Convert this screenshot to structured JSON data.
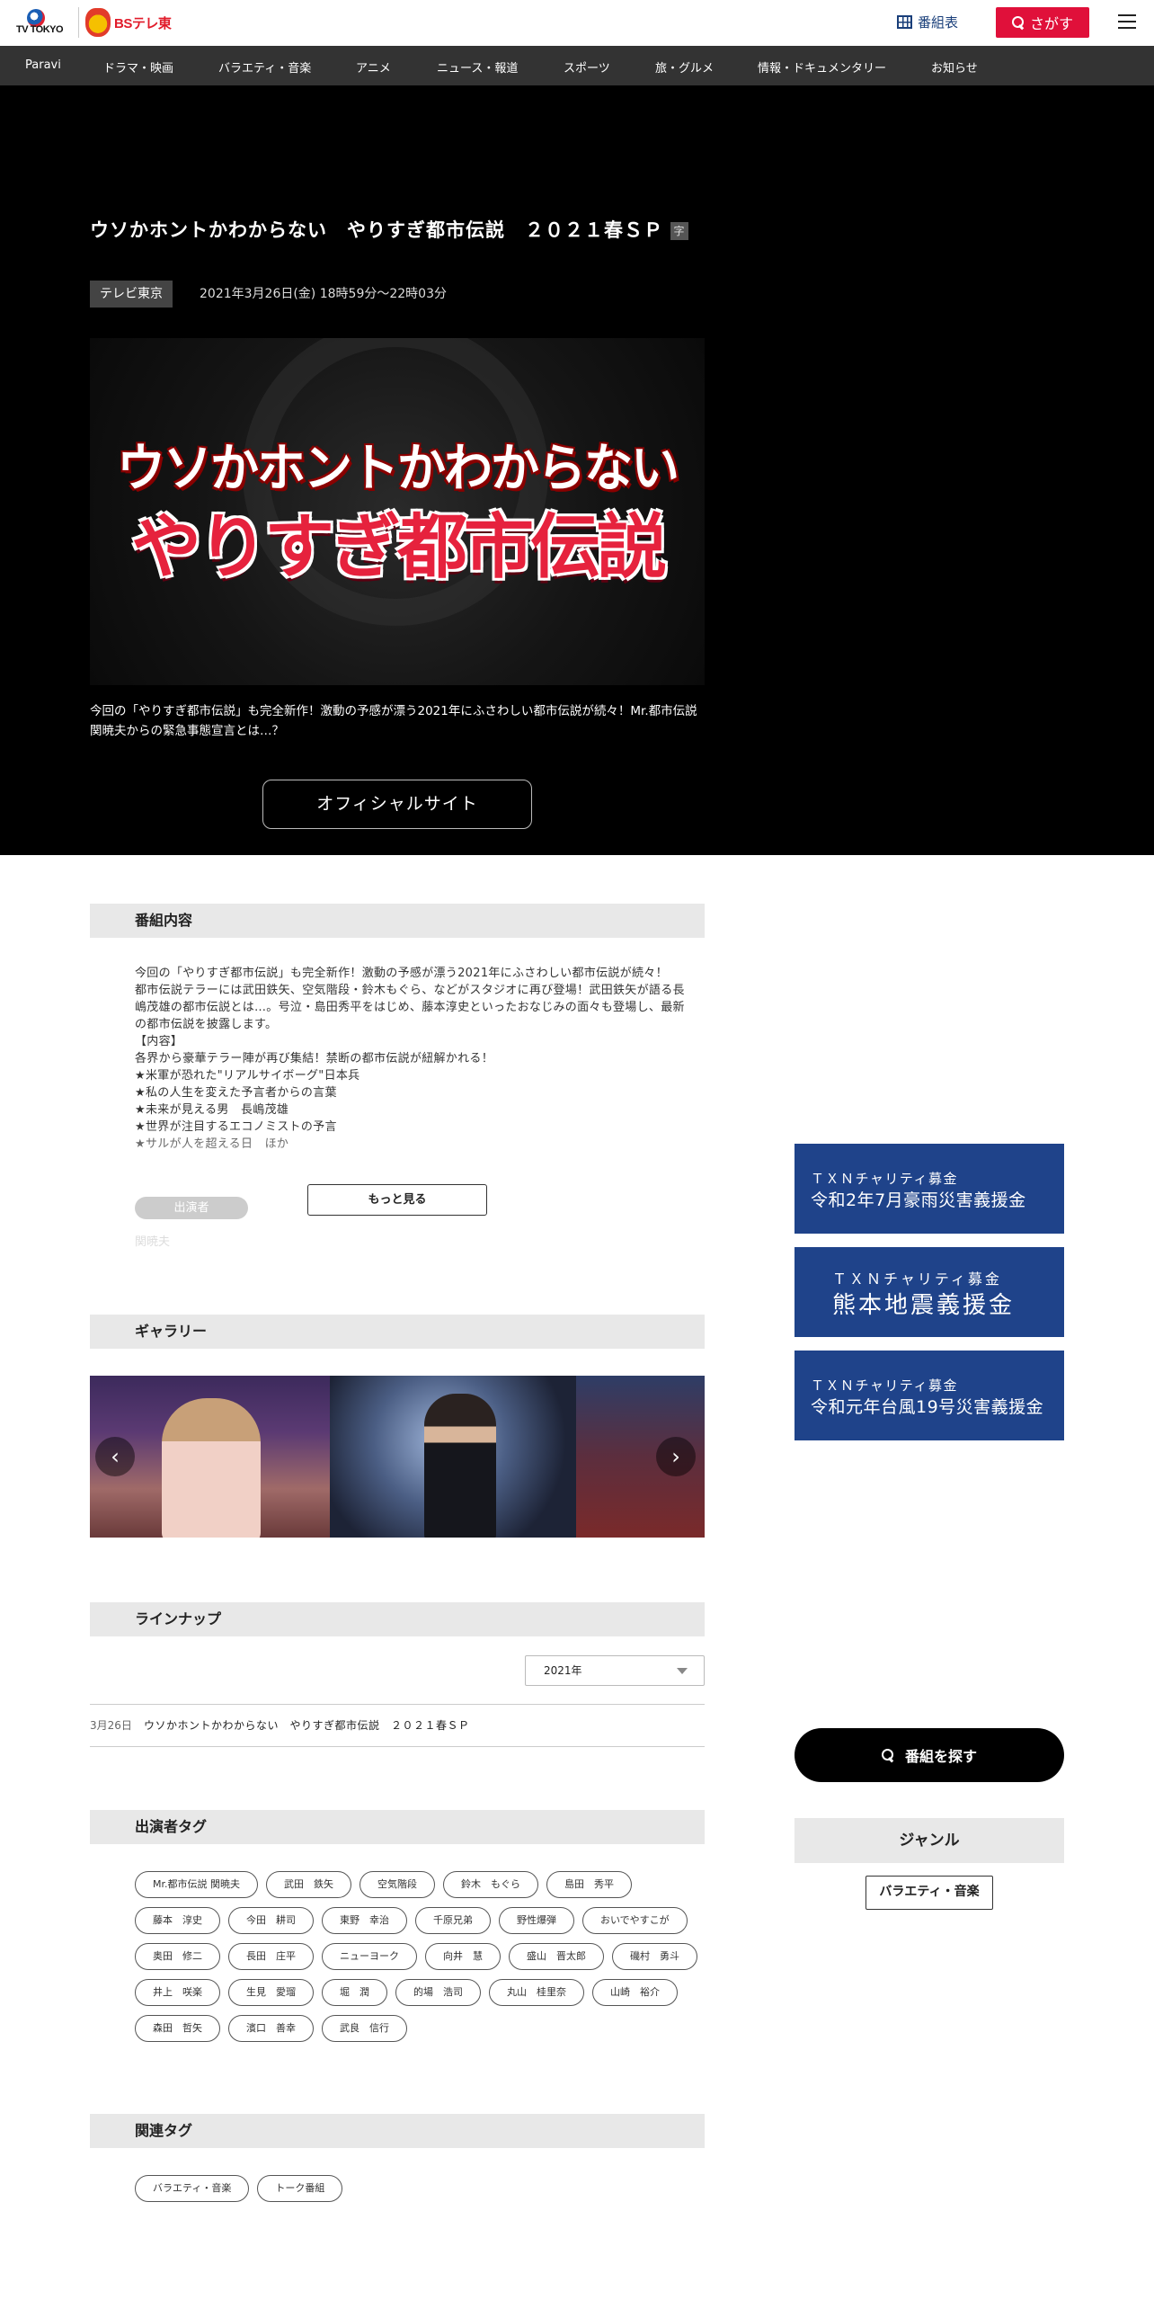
{
  "header": {
    "logo_tvtokyo": "TV TOKYO",
    "logo_bs": "BSテレ東",
    "schedule_label": "番組表",
    "search_label": "さがす"
  },
  "nav": [
    "Paravi",
    "ドラマ・映画",
    "バラエティ・音楽",
    "アニメ",
    "ニュース・報道",
    "スポーツ",
    "旅・グルメ",
    "情報・ドキュメンタリー",
    "お知らせ"
  ],
  "program": {
    "title": "ウソかホントかわからない　やりすぎ都市伝説　２０２１春ＳＰ",
    "subtitle_mark": "字",
    "channel": "テレビ東京",
    "airtime": "2021年3月26日(金) 18時59分～22時03分",
    "hero_logo_line1": "ウソかホントかわからない",
    "hero_logo_line2": "やりすぎ都市伝説",
    "hero_desc": "今回の「やりすぎ都市伝説」も完全新作！激動の予感が漂う2021年にふさわしい都市伝説が続々！Mr.都市伝説関暁夫からの緊急事態宣言とは…？",
    "official_site": "オフィシャルサイト"
  },
  "content": {
    "heading": "番組内容",
    "body": "今回の「やりすぎ都市伝説」も完全新作！激動の予感が漂う2021年にふさわしい都市伝説が続々！\n都市伝説テラーには武田鉄矢、空気階段・鈴木もぐら、などがスタジオに再び登場！武田鉄矢が語る長嶋茂雄の都市伝説とは…。号泣・島田秀平をはじめ、藤本淳史といったおなじみの面々も登場し、最新の都市伝説を披露します。\n【内容】\n各界から豪華テラー陣が再び集結！禁断の都市伝説が紐解かれる！\n★米軍が恐れた\"リアルサイボーグ\"日本兵\n★私の人生を変えた予言者からの言葉\n★未来が見える男　長嶋茂雄\n★世界が注目するエコノミストの予言\n★サルが人を超える日　ほか",
    "cast_label": "出演者",
    "cast_ghost": "関暁夫",
    "more_label": "もっと見る"
  },
  "gallery": {
    "heading": "ギャラリー",
    "prev": "‹",
    "next": "›"
  },
  "lineup": {
    "heading": "ラインナップ",
    "year": "2021年",
    "items": [
      {
        "date": "3月26日",
        "title": "ウソかホントかわからない　やりすぎ都市伝説　２０２１春ＳＰ"
      }
    ]
  },
  "performer_tags": {
    "heading": "出演者タグ",
    "tags": [
      "Mr.都市伝説 関暁夫",
      "武田　鉄矢",
      "空気階段",
      "鈴木　もぐら",
      "島田　秀平",
      "藤本　淳史",
      "今田　耕司",
      "東野　幸治",
      "千原兄弟",
      "野性爆弾",
      "おいでやすこが",
      "奥田　修二",
      "長田　庄平",
      "ニューヨーク",
      "向井　慧",
      "盛山　晋太郎",
      "磯村　勇斗",
      "井上　咲楽",
      "生見　愛瑠",
      "堀　潤",
      "的場　浩司",
      "丸山　桂里奈",
      "山崎　裕介",
      "森田　哲矢",
      "濱口　善幸",
      "武良　信行"
    ]
  },
  "related_tags": {
    "heading": "関連タグ",
    "tags": [
      "バラエティ・音楽",
      "トーク番組"
    ]
  },
  "sidebar": {
    "charity": [
      {
        "line1": "ＴＸＮチャリティ募金",
        "line2": "令和2年7月豪雨災害義援金"
      },
      {
        "line1": "ＴＸＮチャリティ募金",
        "line2": "熊本地震義援金"
      },
      {
        "line1": "ＴＸＮチャリティ募金",
        "line2": "令和元年台風19号災害義援金"
      }
    ],
    "find_program": "番組を探す",
    "genre_heading": "ジャンル",
    "genre_tag": "バラエティ・音楽"
  },
  "colors": {
    "nav_bg": "#333333",
    "search_red": "#e0103a",
    "charity_blue": "#1f438a",
    "section_gray": "#e8e8e8"
  }
}
